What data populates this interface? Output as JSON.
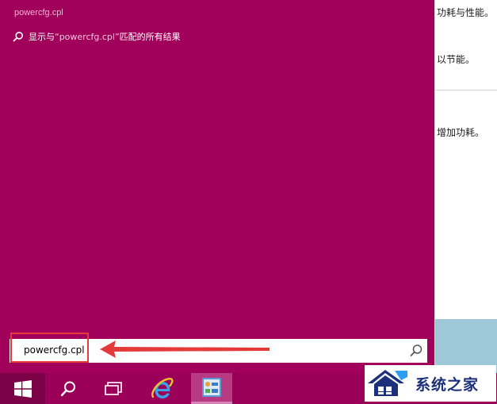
{
  "background_window": {
    "lines": [
      "功耗与性能。",
      "以节能。",
      "增加功耗。"
    ]
  },
  "search_panel": {
    "title": "powercfg.cpl",
    "result": {
      "prefix": "显示与",
      "query": "“powercfg.cpl”",
      "suffix": "匹配的所有结果"
    },
    "search_box": {
      "value": "powercfg.cpl",
      "icon": "search-icon"
    }
  },
  "annotation": {
    "highlight_color": "#e43a3a",
    "arrow_color": "#e43a3a"
  },
  "taskbar": {
    "items": [
      {
        "name": "start-button",
        "icon": "windows-logo-icon"
      },
      {
        "name": "search-button",
        "icon": "search-icon"
      },
      {
        "name": "task-view-button",
        "icon": "task-view-icon"
      },
      {
        "name": "internet-explorer-button",
        "icon": "internet-explorer-icon"
      },
      {
        "name": "control-panel-button",
        "icon": "control-panel-icon"
      }
    ]
  },
  "watermark": {
    "text": "系统之家",
    "icon": "house-logo-icon"
  },
  "colors": {
    "panel": "#a1005b",
    "taskbar": "#9a0057"
  }
}
